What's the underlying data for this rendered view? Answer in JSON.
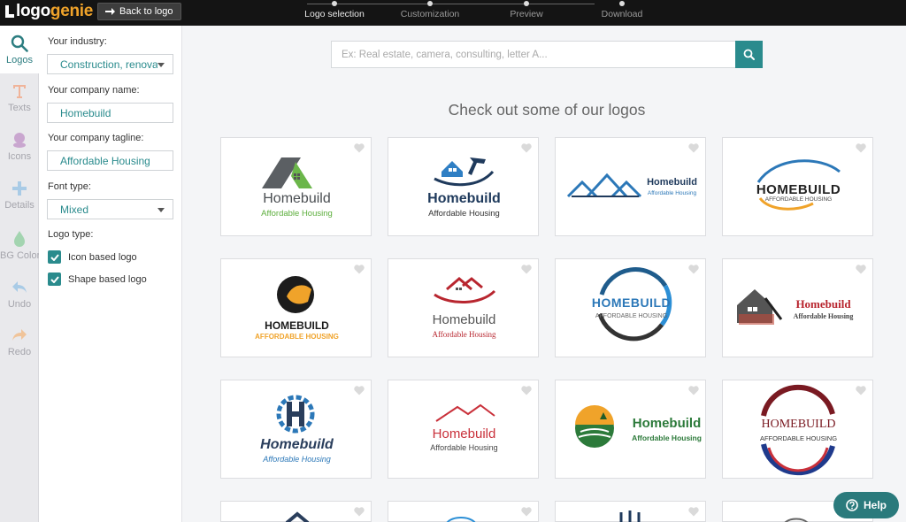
{
  "brand": {
    "logo": "logo",
    "logo_accent": "genie",
    "back_label": "Back to logo"
  },
  "steps": [
    {
      "label": "Logo selection",
      "active": true
    },
    {
      "label": "Customization",
      "active": false
    },
    {
      "label": "Preview",
      "active": false
    },
    {
      "label": "Download",
      "active": false
    }
  ],
  "iconbar": [
    {
      "label": "Logos",
      "icon": "search-icon"
    },
    {
      "label": "Texts",
      "icon": "text-icon"
    },
    {
      "label": "Icons",
      "icon": "icons-icon"
    },
    {
      "label": "Details",
      "icon": "plus-icon"
    },
    {
      "label": "BG Color",
      "icon": "drop-icon"
    },
    {
      "label": "Undo",
      "icon": "undo-icon"
    },
    {
      "label": "Redo",
      "icon": "redo-icon"
    }
  ],
  "form": {
    "industry_label": "Your industry:",
    "industry_value": "Construction, renovation",
    "company_label": "Your company name:",
    "company_value": "Homebuild",
    "tagline_label": "Your company tagline:",
    "tagline_value": "Affordable Housing",
    "font_label": "Font type:",
    "font_value": "Mixed",
    "logo_type_label": "Logo type:",
    "opt_icon": "Icon based logo",
    "opt_shape": "Shape based logo"
  },
  "search": {
    "placeholder": "Ex: Real estate, camera, consulting, letter A..."
  },
  "heading": "Check out some of our logos",
  "logos": [
    {
      "name": "Homebuild",
      "tagline": "Affordable Housing"
    },
    {
      "name": "Homebuild",
      "tagline": "Affordable Housing"
    },
    {
      "name": "Homebuild",
      "tagline": "Affordable Housing"
    },
    {
      "name": "HOMEBUILD",
      "tagline": "AFFORDABLE HOUSING"
    },
    {
      "name": "HOMEBUILD",
      "tagline": "AFFORDABLE HOUSING"
    },
    {
      "name": "Homebuild",
      "tagline": "Affordable Housing"
    },
    {
      "name": "HOMEBUILD",
      "tagline": "AFFORDABLE HOUSING"
    },
    {
      "name": "Homebuild",
      "tagline": "Affordable Housing"
    },
    {
      "name": "Homebuild",
      "tagline": "Affordable Housing"
    },
    {
      "name": "Homebuild",
      "tagline": "Affordable Housing"
    },
    {
      "name": "Homebuild",
      "tagline": "Affordable Housing"
    },
    {
      "name": "HOMEBUILD",
      "tagline": "AFFORDABLE HOUSING"
    }
  ],
  "help_label": "Help",
  "colors": {
    "accent": "#2a8b8d",
    "topbar": "#141414",
    "brand_orange": "#f0a32a"
  }
}
